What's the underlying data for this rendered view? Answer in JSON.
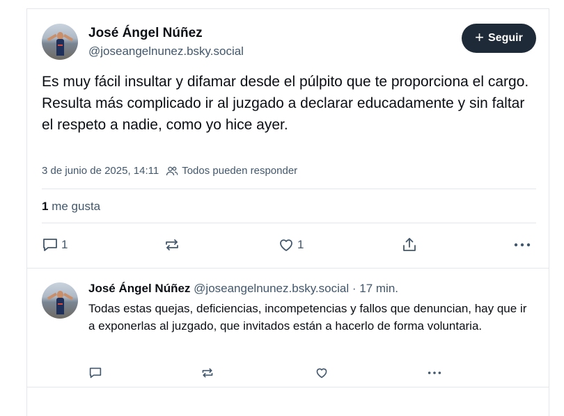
{
  "main_post": {
    "author_name": "José Ángel Núñez",
    "author_handle": "@joseangelnunez.bsky.social",
    "follow_label": "Seguir",
    "text_lines": [
      "Es muy fácil insultar y difamar desde el púlpito que te proporciona el cargo.",
      "Resulta más complicado ir al juzgado a declarar educadamente y sin faltar el respeto a nadie, como yo hice ayer."
    ],
    "timestamp": "3 de junio de 2025, 14:11",
    "reply_setting": "Todos pueden responder",
    "likes_count": "1",
    "likes_label": "me gusta",
    "reply_count": "1",
    "like_count": "1",
    "icons": {
      "reply": "speech-bubble-icon",
      "repost": "repost-icon",
      "like": "heart-icon",
      "share": "share-icon",
      "more": "ellipsis-icon",
      "audience": "people-icon"
    }
  },
  "reply": {
    "author_name": "José Ángel Núñez",
    "author_handle": "@joseangelnunez.bsky.social",
    "time": "· 17 min.",
    "text": "Todas estas quejas, deficiencias, incompetencias y fallos que denuncian, hay que ir a exponerlas al juzgado, que invitados están a hacerlo de forma voluntaria."
  },
  "colors": {
    "text_primary": "#0b0f14",
    "text_secondary": "#42576c",
    "divider": "#e3e7ec",
    "follow_button_bg": "#1e2a37"
  }
}
